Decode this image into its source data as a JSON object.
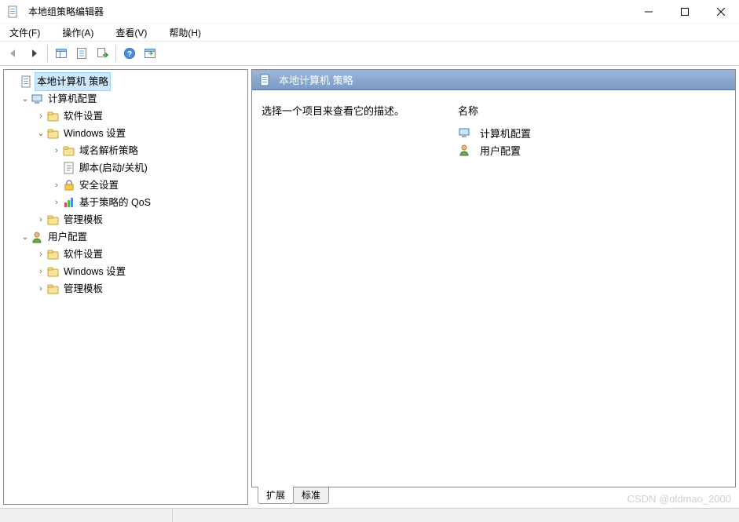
{
  "window": {
    "title": "本地组策略编辑器"
  },
  "menu": {
    "file": "文件(F)",
    "action": "操作(A)",
    "view": "查看(V)",
    "help": "帮助(H)"
  },
  "tree": {
    "root": "本地计算机 策略",
    "computer_config": "计算机配置",
    "software_settings": "软件设置",
    "windows_settings": "Windows 设置",
    "dns_policy": "域名解析策略",
    "scripts": "脚本(启动/关机)",
    "security_settings": "安全设置",
    "qos": "基于策略的 QoS",
    "admin_templates": "管理模板",
    "user_config": "用户配置",
    "u_software_settings": "软件设置",
    "u_windows_settings": "Windows 设置",
    "u_admin_templates": "管理模板"
  },
  "content": {
    "header": "本地计算机 策略",
    "desc": "选择一个项目来查看它的描述。",
    "col_name": "名称",
    "items": {
      "computer": "计算机配置",
      "user": "用户配置"
    }
  },
  "tabs": {
    "extended": "扩展",
    "standard": "标准"
  },
  "watermark": "CSDN @oldmao_2000"
}
